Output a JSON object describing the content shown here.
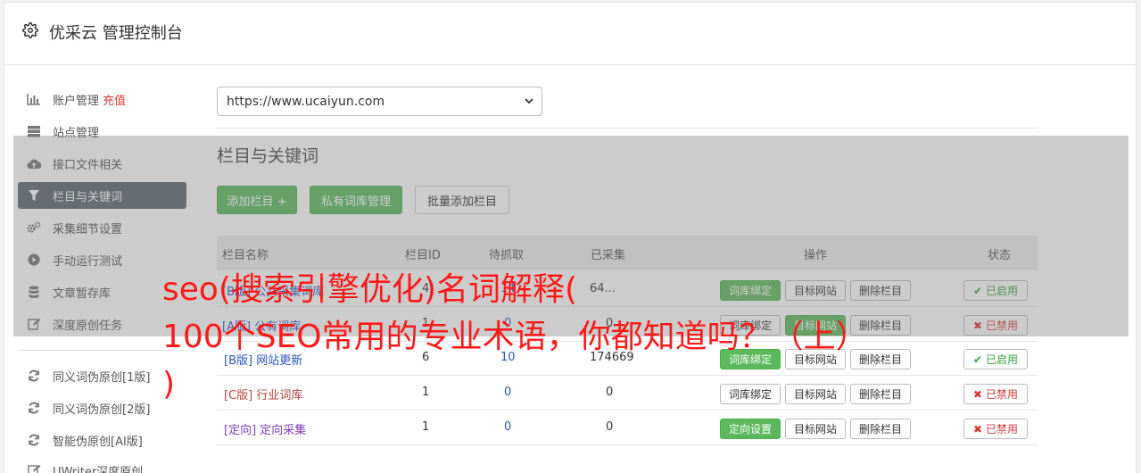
{
  "header": {
    "title": "优采云 管理控制台",
    "icon": "gear-icon"
  },
  "sidebar": {
    "items": [
      {
        "label": "账户管理",
        "extra": "充值",
        "icon": "bar-chart-icon"
      },
      {
        "label": "站点管理",
        "icon": "server-icon"
      },
      {
        "label": "接口文件相关",
        "icon": "cloud-upload-icon"
      },
      {
        "label": "栏目与关键词",
        "icon": "filter-icon",
        "active": true
      },
      {
        "label": "采集细节设置",
        "icon": "cogs-icon"
      },
      {
        "label": "手动运行测试",
        "icon": "play-circle-icon"
      },
      {
        "label": "文章暂存库",
        "icon": "database-icon"
      },
      {
        "label": "深度原创任务",
        "icon": "edit-icon"
      }
    ],
    "items2": [
      {
        "label": "同义词伪原创[1版]",
        "icon": "refresh-icon"
      },
      {
        "label": "同义词伪原创[2版]",
        "icon": "refresh-icon"
      },
      {
        "label": "智能伪原创[AI版]",
        "icon": "refresh-icon"
      },
      {
        "label": "UWriter深度原创",
        "icon": "edit-icon"
      }
    ]
  },
  "site_select": {
    "value": "https://www.ucaiyun.com"
  },
  "section": {
    "title": "栏目与关键词"
  },
  "toolbar": {
    "add_column": "添加栏目 +",
    "private_lib": "私有词库管理",
    "batch_add": "批量添加栏目"
  },
  "table": {
    "headers": [
      "栏目名称",
      "栏目ID",
      "待抓取",
      "已采集",
      "操作",
      "状态"
    ],
    "rows": [
      {
        "tag": "[B版]",
        "name": "公共采集词库",
        "id": "4",
        "pending": "14",
        "collected": "64...",
        "action1": "词库绑定",
        "action2": "目标网站",
        "action3": "删除栏目",
        "status": "已启用"
      },
      {
        "tag": "[A版]",
        "name": "公有词库",
        "id": "1",
        "pending": "0",
        "collected": "0",
        "action1": "词库绑定",
        "action2": "目标网站",
        "action3": "删除栏目",
        "status": "已禁用"
      },
      {
        "tag": "[B版]",
        "name": "网站更新",
        "id": "6",
        "pending": "10",
        "collected": "174669",
        "action1": "词库绑定",
        "action2": "目标网站",
        "action3": "删除栏目",
        "status": "已启用"
      },
      {
        "tag": "[C版]",
        "name": "行业词库",
        "id": "1",
        "pending": "0",
        "collected": "0",
        "action1": "词库绑定",
        "action2": "目标网站",
        "action3": "删除栏目",
        "status": "已禁用"
      },
      {
        "tag": "[定向]",
        "name": "定向采集",
        "id": "1",
        "pending": "0",
        "collected": "0",
        "action1": "定向设置",
        "action2": "目标网站",
        "action3": "删除栏目",
        "status": "已禁用"
      }
    ]
  },
  "watermark": {
    "line1": "seo(搜索引擎优化)名词解释(",
    "line2": "100个SEO常用的专业术语，你都知道吗？（上）",
    "line3": ")"
  },
  "colors": {
    "accent_green": "#5cb85c",
    "active_nav": "#5c6670",
    "watermark_red": "#ff1a1a"
  }
}
